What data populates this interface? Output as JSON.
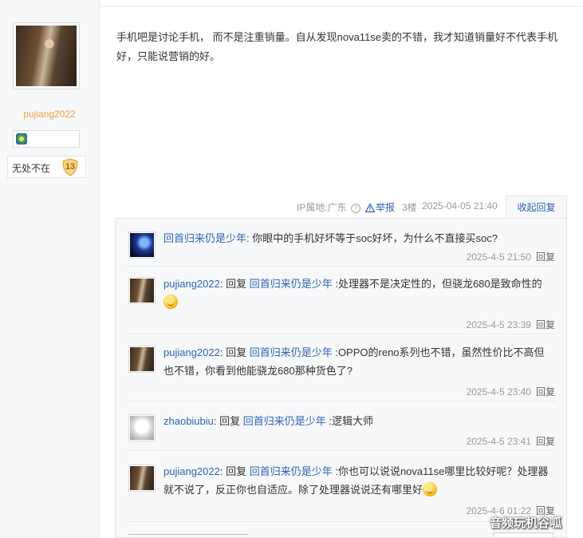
{
  "author": {
    "username": "pujiang2022",
    "level_label": "无处不在",
    "level_number": "13"
  },
  "post": {
    "content": "手机吧是讨论手机，  而不是注重销量。自从发现nova11se卖的不错，我才知道销量好不代表手机好，只能说营销的好。",
    "ip_location": "IP属地:广东",
    "report_label": "举报",
    "floor": "3楼",
    "time": "2025-04-05 21:40",
    "collapse_label": "收起回复"
  },
  "replies": [
    {
      "user": "回首归来仍是少年",
      "reply_word": "",
      "target": "",
      "text": ": 你眼中的手机好坏等于soc好坏，为什么不直接买soc?",
      "time": "2025-4-5 21:50",
      "reply_label": "回复",
      "avatar_icon": "moon-avatar"
    },
    {
      "user": "pujiang2022",
      "reply_word": ": 回复 ",
      "target": "回首归来仍是少年",
      "text": " :处理器不是决定性的，但骁龙680是致命性的",
      "time": "2025-4-5 23:39",
      "reply_label": "回复",
      "avatar_icon": "lady-avatar",
      "emoji": "smile-emoji"
    },
    {
      "user": "pujiang2022",
      "reply_word": ": 回复 ",
      "target": "回首归来仍是少年",
      "text": " :OPPO的reno系列也不错，虽然性价比不高但也不错，你看到他能骁龙680那种货色了?",
      "time": "2025-4-5 23:40",
      "reply_label": "回复",
      "avatar_icon": "lady-avatar"
    },
    {
      "user": "zhaobiubiu",
      "reply_word": ": 回复 ",
      "target": "回首归来仍是少年",
      "text": " :逻辑大师",
      "time": "2025-4-5 23:41",
      "reply_label": "回复",
      "avatar_icon": "dog-avatar"
    },
    {
      "user": "pujiang2022",
      "reply_word": ": 回复 ",
      "target": "回首归来仍是少年",
      "text": " :你也可以说说nova11se哪里比较好呢？处理器就不说了，反正你也自适应。除了处理器说说还有哪里好",
      "time": "2025-4-6 01:22",
      "reply_label": "回复",
      "avatar_icon": "lady-avatar",
      "emoji": "smile-emoji"
    }
  ],
  "watermark": "音频玩机谷呱"
}
